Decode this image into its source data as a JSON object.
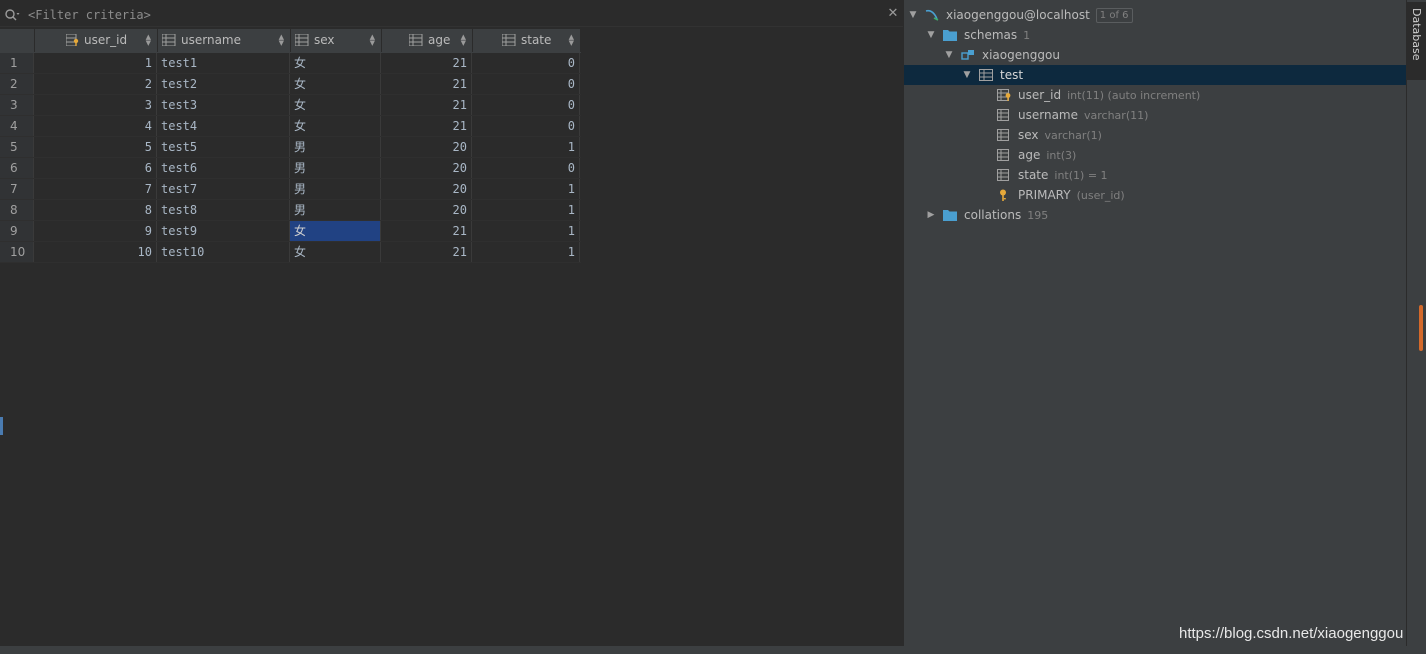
{
  "filter": {
    "placeholder": "<Filter criteria>"
  },
  "grid": {
    "columns": [
      {
        "label": "user_id",
        "icon": "key-column-icon"
      },
      {
        "label": "username",
        "icon": "column-icon"
      },
      {
        "label": "sex",
        "icon": "column-icon"
      },
      {
        "label": "age",
        "icon": "column-icon"
      },
      {
        "label": "state",
        "icon": "column-icon"
      }
    ],
    "rows": [
      {
        "n": "1",
        "user_id": "1",
        "username": "test1",
        "sex": "女",
        "age": "21",
        "state": "0"
      },
      {
        "n": "2",
        "user_id": "2",
        "username": "test2",
        "sex": "女",
        "age": "21",
        "state": "0"
      },
      {
        "n": "3",
        "user_id": "3",
        "username": "test3",
        "sex": "女",
        "age": "21",
        "state": "0"
      },
      {
        "n": "4",
        "user_id": "4",
        "username": "test4",
        "sex": "女",
        "age": "21",
        "state": "0"
      },
      {
        "n": "5",
        "user_id": "5",
        "username": "test5",
        "sex": "男",
        "age": "20",
        "state": "1"
      },
      {
        "n": "6",
        "user_id": "6",
        "username": "test6",
        "sex": "男",
        "age": "20",
        "state": "0"
      },
      {
        "n": "7",
        "user_id": "7",
        "username": "test7",
        "sex": "男",
        "age": "20",
        "state": "1"
      },
      {
        "n": "8",
        "user_id": "8",
        "username": "test8",
        "sex": "男",
        "age": "20",
        "state": "1"
      },
      {
        "n": "9",
        "user_id": "9",
        "username": "test9",
        "sex": "女",
        "age": "21",
        "state": "1"
      },
      {
        "n": "10",
        "user_id": "10",
        "username": "test10",
        "sex": "女",
        "age": "21",
        "state": "1"
      }
    ],
    "selected": {
      "row": "9",
      "column": "sex"
    }
  },
  "tree": {
    "connection": {
      "label": "xiaogenggou@localhost",
      "badge": "1 of 6"
    },
    "schemas": {
      "label": "schemas",
      "count": "1"
    },
    "schema": {
      "label": "xiaogenggou"
    },
    "table": {
      "label": "test"
    },
    "columns": [
      {
        "name": "user_id",
        "type": "int(11) (auto increment)",
        "icon": "key-column-icon"
      },
      {
        "name": "username",
        "type": "varchar(11)",
        "icon": "column-icon"
      },
      {
        "name": "sex",
        "type": "varchar(1)",
        "icon": "column-icon"
      },
      {
        "name": "age",
        "type": "int(3)",
        "icon": "column-icon"
      },
      {
        "name": "state",
        "type": "int(1) = 1",
        "icon": "column-icon"
      }
    ],
    "primary": {
      "label": "PRIMARY",
      "meta": "(user_id)"
    },
    "collations": {
      "label": "collations",
      "count": "195"
    }
  },
  "side_tab": {
    "label": "Database"
  },
  "watermark": "https://blog.csdn.net/xiaogenggou",
  "colors": {
    "background": "#2b2b2b",
    "panel": "#3c3f41",
    "selection": "#214283",
    "active_row": "#0d293e",
    "folder": "#4a9fd0",
    "key": "#e6a93a"
  }
}
